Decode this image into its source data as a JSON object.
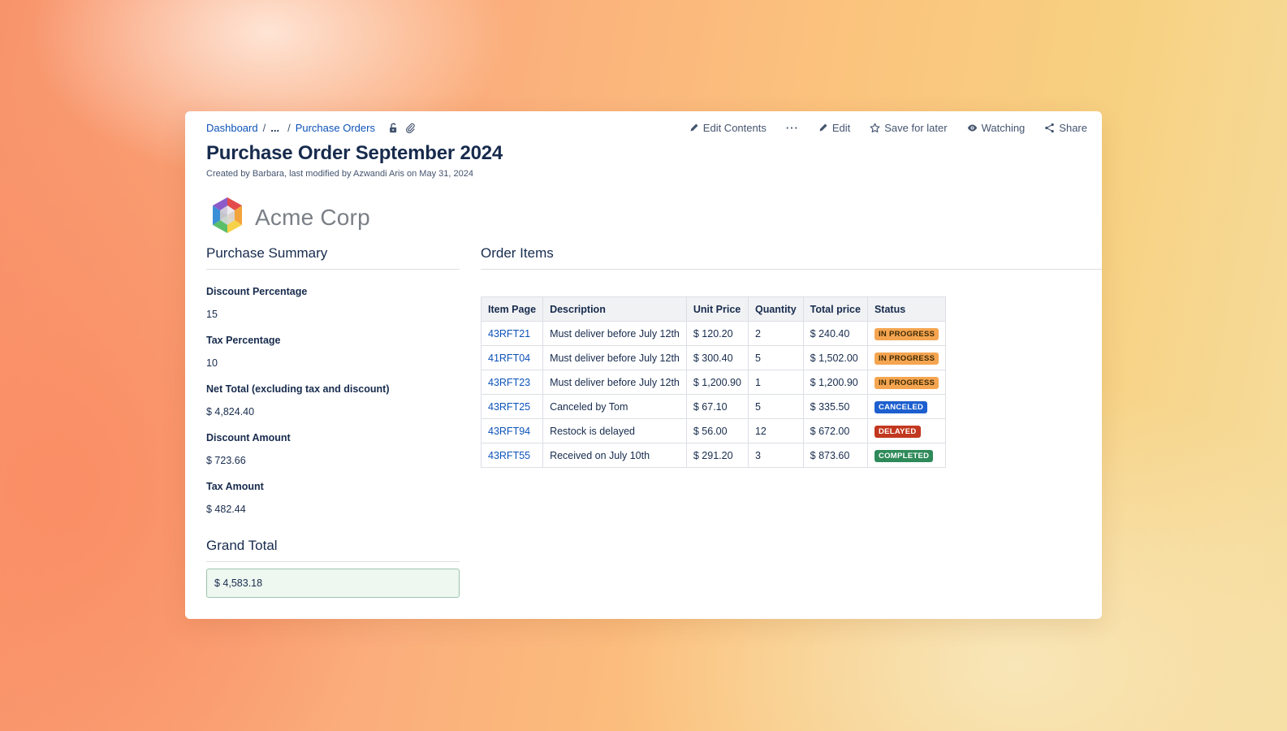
{
  "breadcrumb": {
    "home": "Dashboard",
    "ellipsis": "...",
    "separator": "/",
    "parent": "Purchase Orders"
  },
  "actions": {
    "edit_contents": "Edit Contents",
    "more": "···",
    "edit": "Edit",
    "save_for_later": "Save for later",
    "watching": "Watching",
    "share": "Share"
  },
  "page": {
    "title": "Purchase Order September 2024",
    "byline": "Created by Barbara, last modified by Azwandi Aris on May 31, 2024"
  },
  "logo": {
    "name": "Acme Corp"
  },
  "summary": {
    "heading": "Purchase Summary",
    "fields": [
      {
        "label": "Discount Percentage",
        "value": "15"
      },
      {
        "label": "Tax Percentage",
        "value": "10"
      },
      {
        "label": "Net Total (excluding tax and discount)",
        "value": "$ 4,824.40"
      },
      {
        "label": "Discount Amount",
        "value": "$ 723.66"
      },
      {
        "label": "Tax Amount",
        "value": "$ 482.44"
      }
    ],
    "grand_total_heading": "Grand Total",
    "grand_total_value": "$ 4,583.18"
  },
  "orders": {
    "heading": "Order Items",
    "columns": [
      "Item Page",
      "Description",
      "Unit Price",
      "Quantity",
      "Total price",
      "Status"
    ],
    "rows": [
      {
        "item": "43RFT21",
        "description": "Must deliver before July 12th",
        "unit_price": "$ 120.20",
        "quantity": "2",
        "total": "$ 240.40",
        "status": "IN PROGRESS",
        "status_bg": "#f5a550",
        "status_fg": "#3d2a05"
      },
      {
        "item": "41RFT04",
        "description": "Must deliver before July 12th",
        "unit_price": "$ 300.40",
        "quantity": "5",
        "total": "$ 1,502.00",
        "status": "IN PROGRESS",
        "status_bg": "#f5a550",
        "status_fg": "#3d2a05"
      },
      {
        "item": "43RFT23",
        "description": "Must deliver before July 12th",
        "unit_price": "$ 1,200.90",
        "quantity": "1",
        "total": "$ 1,200.90",
        "status": "IN PROGRESS",
        "status_bg": "#f5a550",
        "status_fg": "#3d2a05"
      },
      {
        "item": "43RFT25",
        "description": "Canceled by Tom",
        "unit_price": "$ 67.10",
        "quantity": "5",
        "total": "$ 335.50",
        "status": "CANCELED",
        "status_bg": "#1d5fcf",
        "status_fg": "#ffffff"
      },
      {
        "item": "43RFT94",
        "description": "Restock is delayed",
        "unit_price": "$ 56.00",
        "quantity": "12",
        "total": "$ 672.00",
        "status": "DELAYED",
        "status_bg": "#c2371f",
        "status_fg": "#ffffff"
      },
      {
        "item": "43RFT55",
        "description": "Received on July 10th",
        "unit_price": "$ 291.20",
        "quantity": "3",
        "total": "$ 873.60",
        "status": "COMPLETED",
        "status_bg": "#2f8a5a",
        "status_fg": "#ffffff"
      }
    ]
  },
  "colors": {
    "link": "#0c52b8",
    "text": "#172b4d",
    "grand_total_bg": "#eef7f0",
    "grand_total_border": "#9ec5ad"
  },
  "icons": [
    "unlock-icon",
    "paperclip-icon",
    "pencil-icon",
    "more-icon",
    "star-icon",
    "eye-icon",
    "share-icon",
    "hexagon-logo-icon"
  ]
}
